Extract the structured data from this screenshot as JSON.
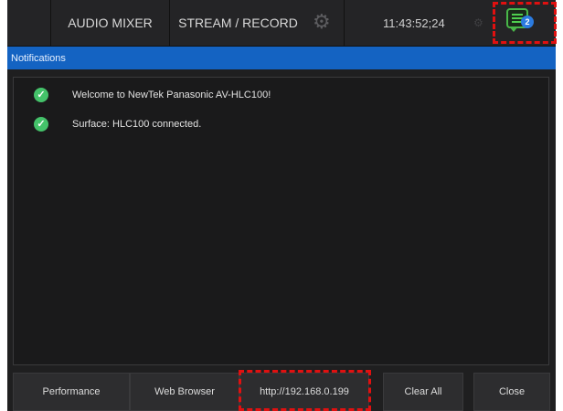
{
  "topbar": {
    "audio_mixer": "AUDIO MIXER",
    "stream_record": "STREAM / RECORD",
    "time": "11:43:52;24",
    "notification_count": "2"
  },
  "panel": {
    "title": "Notifications",
    "items": [
      {
        "text": "Welcome to NewTek Panasonic AV-HLC100!",
        "icon": "check-icon"
      },
      {
        "text": "Surface: HLC100 connected.",
        "icon": "check-icon"
      }
    ]
  },
  "footer": {
    "performance": "Performance",
    "web_browser": "Web Browser",
    "url": "http://192.168.0.199",
    "clear_all": "Clear All",
    "close": "Close"
  },
  "colors": {
    "accent": "#1463c2",
    "success": "#44c26a",
    "highlight": "#e01010",
    "background": "#1f1f20"
  }
}
